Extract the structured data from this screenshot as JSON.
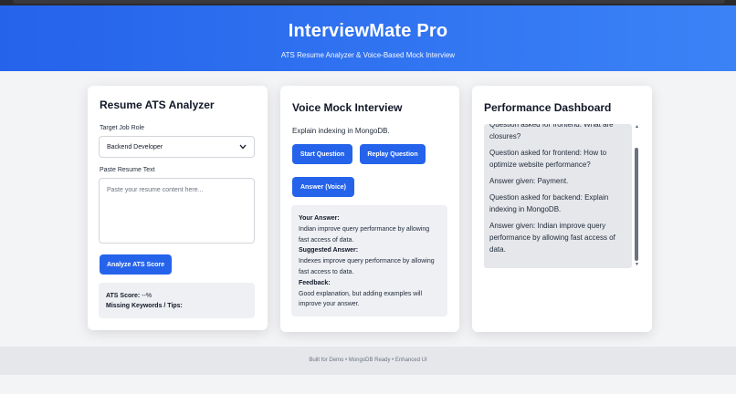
{
  "header": {
    "title": "InterviewMate Pro",
    "subtitle": "ATS Resume Analyzer & Voice-Based Mock Interview"
  },
  "ats": {
    "title": "Resume ATS Analyzer",
    "role_label": "Target Job Role",
    "role_value": "Backend Developer",
    "resume_label": "Paste Resume Text",
    "resume_placeholder": "Paste your resume content here...",
    "analyze_button": "Analyze ATS Score",
    "score_label": "ATS Score:",
    "score_value": "--%",
    "missing_label": "Missing Keywords / Tips:"
  },
  "voice": {
    "title": "Voice Mock Interview",
    "question": "Explain indexing in MongoDB.",
    "start_button": "Start Question",
    "replay_button": "Replay Question",
    "answer_button": "Answer (Voice)",
    "your_answer_label": "Your Answer:",
    "your_answer": "Indian improve query performance by allowing fast access of data.",
    "suggested_label": "Suggested Answer:",
    "suggested_answer": "Indexes improve query performance by allowing fast access to data.",
    "feedback_label": "Feedback:",
    "feedback": "Good explanation, but adding examples will improve your answer."
  },
  "performance": {
    "title": "Performance Dashboard",
    "log": [
      "Question asked for frontend: What are closures?",
      "Question asked for frontend: How to optimize website performance?",
      "Answer given: Payment.",
      "Question asked for backend: Explain indexing in MongoDB.",
      "Answer given: Indian improve query performance by allowing fast access of data."
    ]
  },
  "footer": {
    "text": "Built for Demo • MongoDB Ready • Enhanced UI"
  },
  "colors": {
    "primary": "#2563eb",
    "header_gradient_start": "#2563eb",
    "header_gradient_end": "#3b82f6"
  }
}
